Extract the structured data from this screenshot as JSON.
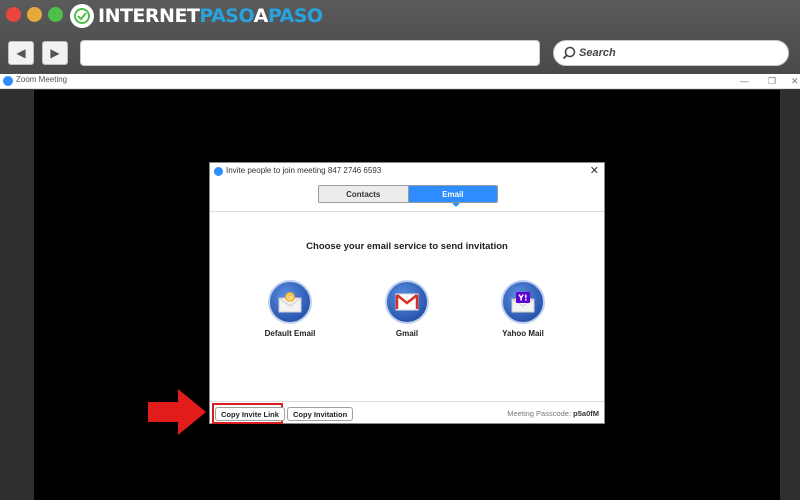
{
  "browser": {
    "brand": {
      "part1": "INTERNET",
      "part2": "PASO",
      "part3": "A",
      "part4": "PASO"
    },
    "search_placeholder": "Search"
  },
  "zoom_window": {
    "title": "Zoom Meeting"
  },
  "dialog": {
    "title": "Invite people to join meeting 847 2746 6593",
    "tabs": [
      {
        "label": "Contacts",
        "active": false
      },
      {
        "label": "Email",
        "active": true
      }
    ],
    "heading": "Choose your email service to send invitation",
    "services": [
      {
        "label": "Default Email",
        "icon": "default-email-icon"
      },
      {
        "label": "Gmail",
        "icon": "gmail-icon"
      },
      {
        "label": "Yahoo Mail",
        "icon": "yahoo-mail-icon"
      }
    ],
    "footer": {
      "copy_invite_link": "Copy Invite Link",
      "copy_invitation": "Copy Invitation",
      "passcode_label": "Meeting Passcode:",
      "passcode_value": "p5a0fM"
    }
  },
  "colors": {
    "accent": "#2d8cff",
    "highlight": "#d81e1e",
    "brand_accent": "#29a3e0"
  }
}
